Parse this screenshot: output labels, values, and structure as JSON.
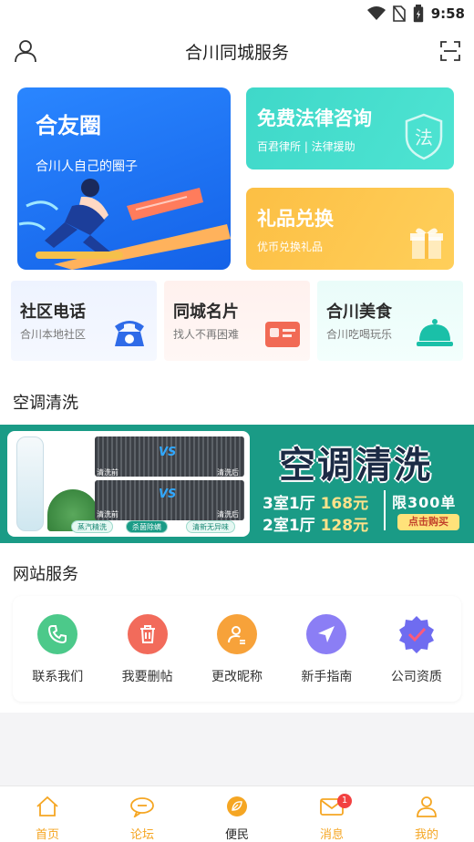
{
  "status": {
    "time": "9:58"
  },
  "header": {
    "title": "合川同城服务",
    "left_icon": "user-icon",
    "right_icon": "scan-icon"
  },
  "cards": {
    "circle": {
      "title": "合友圈",
      "subtitle": "合川人自己的圈子",
      "color": "#2a86ff"
    },
    "legal": {
      "title": "免费法律咨询",
      "subtitle": "百君律所 | 法律援助",
      "icon_text": "法",
      "color": "#3fd8c9"
    },
    "gift": {
      "title": "礼品兑换",
      "subtitle": "优币兑换礼品",
      "color": "#fcbf44"
    }
  },
  "quick": [
    {
      "title": "社区电话",
      "subtitle": "合川本地社区",
      "icon": "phone-icon"
    },
    {
      "title": "同城名片",
      "subtitle": "找人不再困难",
      "icon": "card-icon"
    },
    {
      "title": "合川美食",
      "subtitle": "合川吃喝玩乐",
      "icon": "cloche-icon"
    }
  ],
  "section_ac": "空调清洗",
  "banner": {
    "title": "空调清洗",
    "before1": "清洗前",
    "after1": "清洗后",
    "before2": "清洗前",
    "after2": "清洗后",
    "vs": "VS",
    "tags": [
      "蒸汽精洗",
      "杀菌除螨",
      "清新无异味"
    ],
    "price1_room": "3室1厅",
    "price1": "168元",
    "price2_room": "2室1厅",
    "price2": "128元",
    "limit": "限300单",
    "buy": "点击购买"
  },
  "section_site": "网站服务",
  "services": [
    {
      "label": "联系我们",
      "icon": "phone-icon",
      "color": "#4cc98a"
    },
    {
      "label": "我要删帖",
      "icon": "trash-icon",
      "color": "#f26b5b"
    },
    {
      "label": "更改昵称",
      "icon": "user-edit-icon",
      "color": "#f7a23a"
    },
    {
      "label": "新手指南",
      "icon": "navigation-icon",
      "color": "#8b7ef5"
    },
    {
      "label": "公司资质",
      "icon": "badge-check-icon",
      "color": "#6f6cf0"
    }
  ],
  "tabs": [
    {
      "label": "首页",
      "icon": "home-icon"
    },
    {
      "label": "论坛",
      "icon": "chat-icon"
    },
    {
      "label": "便民",
      "icon": "leaf-icon",
      "active": true
    },
    {
      "label": "消息",
      "icon": "mail-icon",
      "badge": "1"
    },
    {
      "label": "我的",
      "icon": "profile-icon"
    }
  ]
}
